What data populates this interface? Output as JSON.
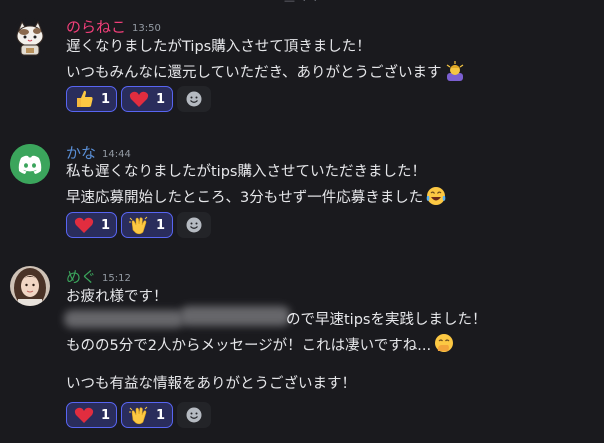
{
  "top_fragment": "— · ·",
  "messages": [
    {
      "author": "のらねこ",
      "author_color": "#f23f7a",
      "time": "13:50",
      "lines": [
        "遅くなりましたがTips購入させて頂きました！",
        "いつもみんなに還元していただき、ありがとうございます"
      ],
      "reactions": [
        {
          "emoji": "thumbs-up-icon",
          "count": "1"
        },
        {
          "emoji": "heart-icon",
          "count": "1"
        }
      ]
    },
    {
      "author": "かな",
      "author_color": "#5a8fd6",
      "time": "14:44",
      "lines": [
        "私も遅くなりましたがtips購入させていただきました！",
        "早速応募開始したところ、3分もせず一件応募きました"
      ],
      "reactions": [
        {
          "emoji": "heart-icon",
          "count": "1"
        },
        {
          "emoji": "clapping-hands-icon",
          "count": "1"
        }
      ]
    },
    {
      "author": "めぐ",
      "author_color": "#3ba55c",
      "time": "15:12",
      "lines": [
        "お疲れ様です！",
        "ので早速tipsを実践しました！",
        "ものの5分で2人からメッセージが！これは凄いですね...",
        "",
        "いつも有益な情報をありがとうございます！"
      ],
      "reactions": [
        {
          "emoji": "heart-icon",
          "count": "1"
        },
        {
          "emoji": "clapping-hands-icon",
          "count": "1"
        }
      ]
    }
  ],
  "colors": {
    "background": "#1a1a1e",
    "reaction_bg": "#2a2d5c",
    "reaction_border": "#5865f2",
    "discord_blurple": "#3ba55c"
  }
}
